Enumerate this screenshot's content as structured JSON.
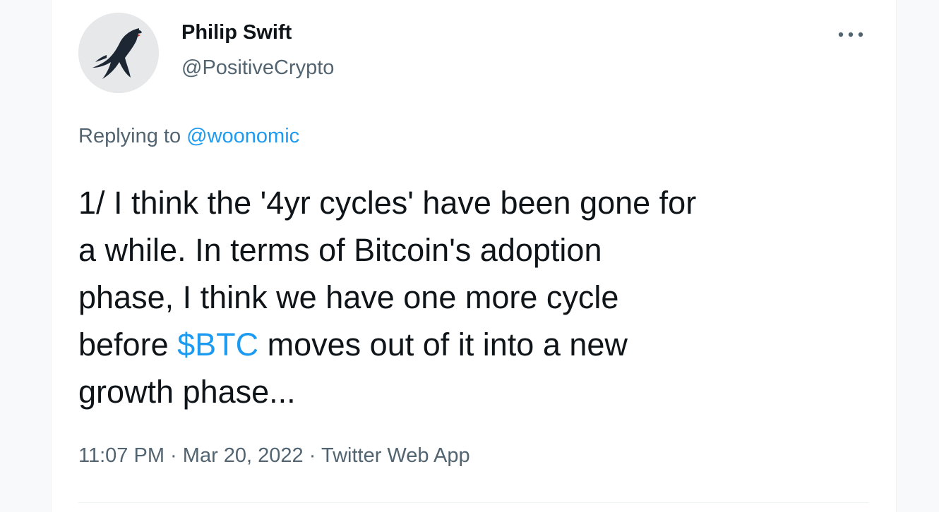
{
  "author": {
    "display_name": "Philip Swift",
    "handle": "@PositiveCrypto",
    "avatar_icon": "swallow-bird-icon"
  },
  "more_icon": "more-dots-icon",
  "reply": {
    "prefix": "Replying to",
    "target": "@woonomic"
  },
  "tweet": {
    "line1": "1/ I think the '4yr cycles' have been gone for",
    "line2": "a while.  In terms of Bitcoin's adoption",
    "line3": "phase, I think we have one more cycle",
    "line4_before": "before ",
    "cashtag": "$BTC",
    "line4_after": " moves out of it into a new",
    "line5": "growth phase..."
  },
  "meta": {
    "time": "11:07 PM",
    "separator": "·",
    "date": "Mar 20, 2022",
    "source": "Twitter Web App"
  },
  "colors": {
    "link_blue": "#1d9bf0",
    "text_primary": "#0f1419",
    "text_secondary": "#536471"
  }
}
